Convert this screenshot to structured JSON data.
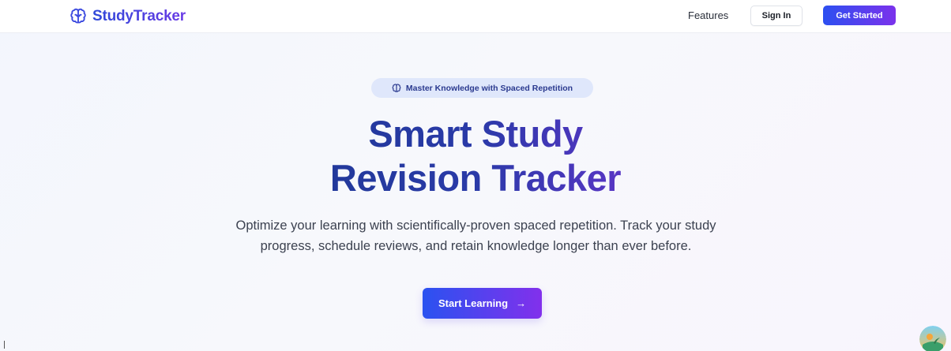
{
  "header": {
    "brand_name": "StudyTracker",
    "brand_icon": "brain-icon",
    "nav_features": "Features",
    "signin_label": "Sign In",
    "getstarted_label": "Get Started"
  },
  "hero": {
    "badge_icon": "brain-icon",
    "badge_text": "Master Knowledge with Spaced Repetition",
    "title_line1": "Smart Study",
    "title_line2": "Revision Tracker",
    "subtitle": "Optimize your learning with scientifically-proven spaced repetition. Track your study progress, schedule reviews, and retain knowledge longer than ever before.",
    "cta_label": "Start Learning",
    "cta_icon": "arrow-right-icon"
  },
  "colors": {
    "brand_gradient_start": "#2f49d9",
    "brand_gradient_end": "#6a3be6",
    "title_start": "#1c3891",
    "title_end": "#7a32d9",
    "badge_bg": "#dfe7fb",
    "cta_start": "#2a52f0",
    "cta_end": "#8230ec"
  }
}
